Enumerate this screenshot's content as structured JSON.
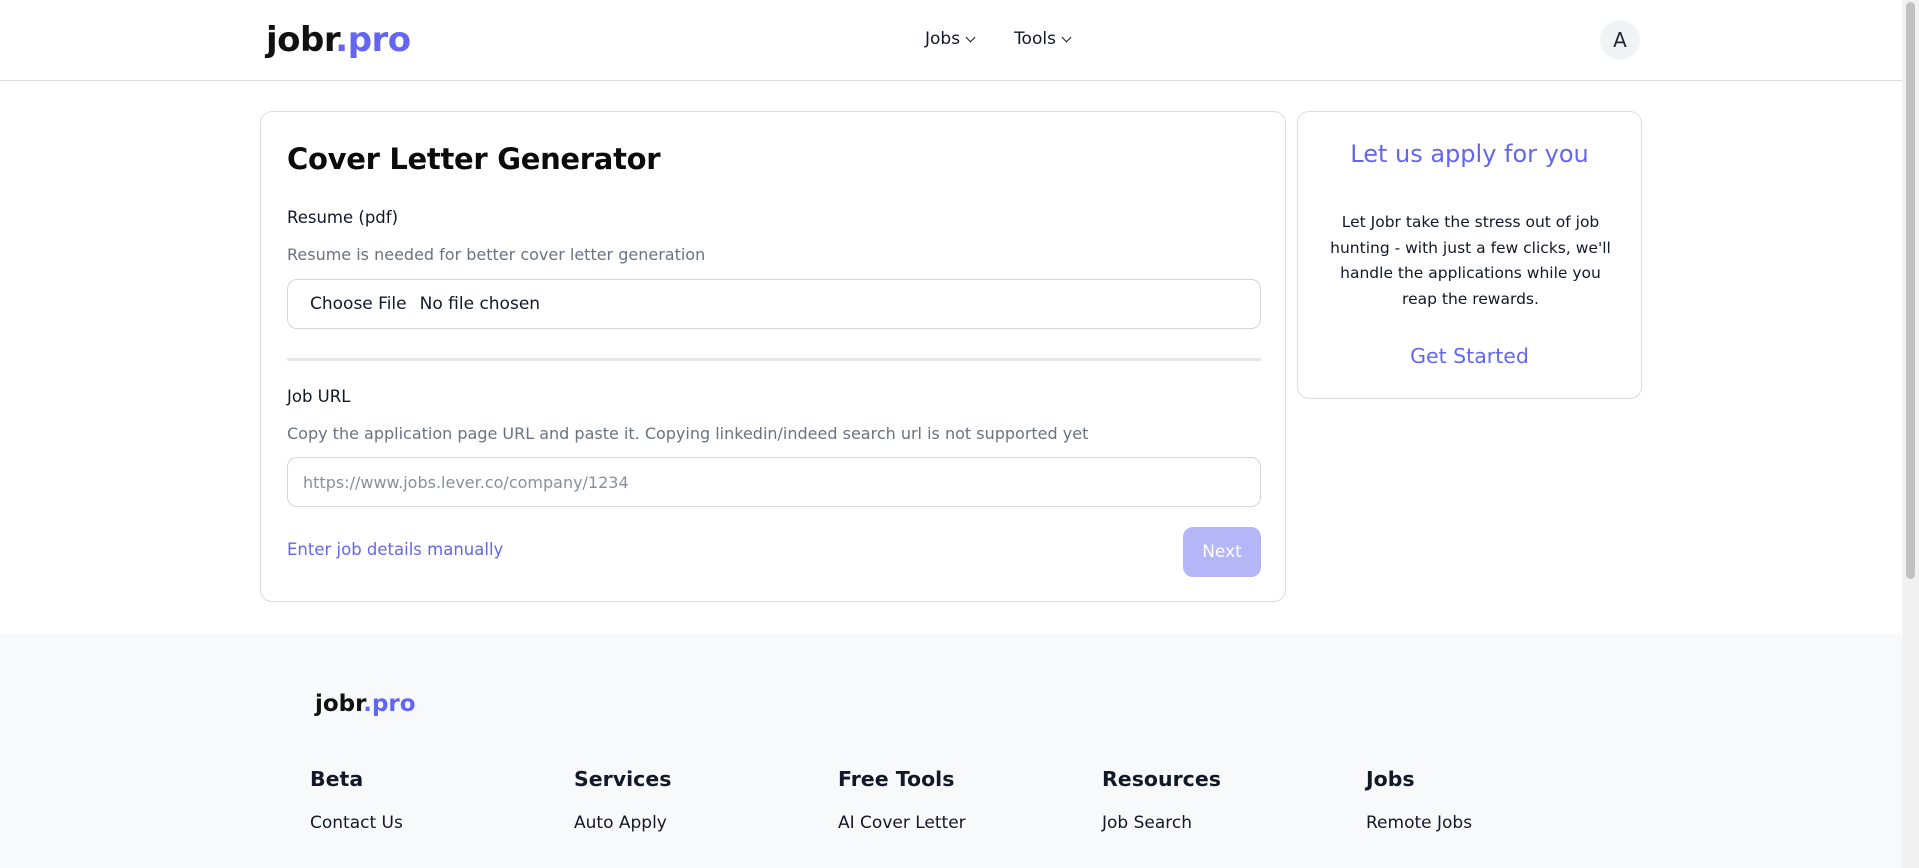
{
  "header": {
    "logo_brand": "jobr",
    "logo_accent": ".pro",
    "nav": [
      {
        "label": "Jobs"
      },
      {
        "label": "Tools"
      }
    ],
    "avatar_initial": "A"
  },
  "main": {
    "title": "Cover Letter Generator",
    "resume": {
      "label": "Resume (pdf)",
      "help": "Resume is needed for better cover letter generation",
      "button_label": "Choose File",
      "status": "No file chosen"
    },
    "job_url": {
      "label": "Job URL",
      "help": "Copy the application page URL and paste it. Copying linkedin/indeed search url is not supported yet",
      "value": "",
      "placeholder": "https://www.jobs.lever.co/company/1234"
    },
    "manual_link": "Enter job details manually",
    "next_label": "Next"
  },
  "side": {
    "title": "Let us apply for you",
    "text": "Let Jobr take the stress out of job hunting - with just a few clicks, we'll handle the applications while you reap the rewards.",
    "cta": "Get Started"
  },
  "footer": {
    "logo_brand": "jobr",
    "logo_accent": ".pro",
    "columns": [
      {
        "heading": "Beta",
        "link": "Contact Us"
      },
      {
        "heading": "Services",
        "link": "Auto Apply"
      },
      {
        "heading": "Free Tools",
        "link": "AI Cover Letter"
      },
      {
        "heading": "Resources",
        "link": "Job Search"
      },
      {
        "heading": "Jobs",
        "link": "Remote Jobs"
      }
    ]
  },
  "colors": {
    "accent": "#6366f1",
    "next_disabled": "#b4b6f7",
    "footer_bg": "#f8f9fa"
  }
}
